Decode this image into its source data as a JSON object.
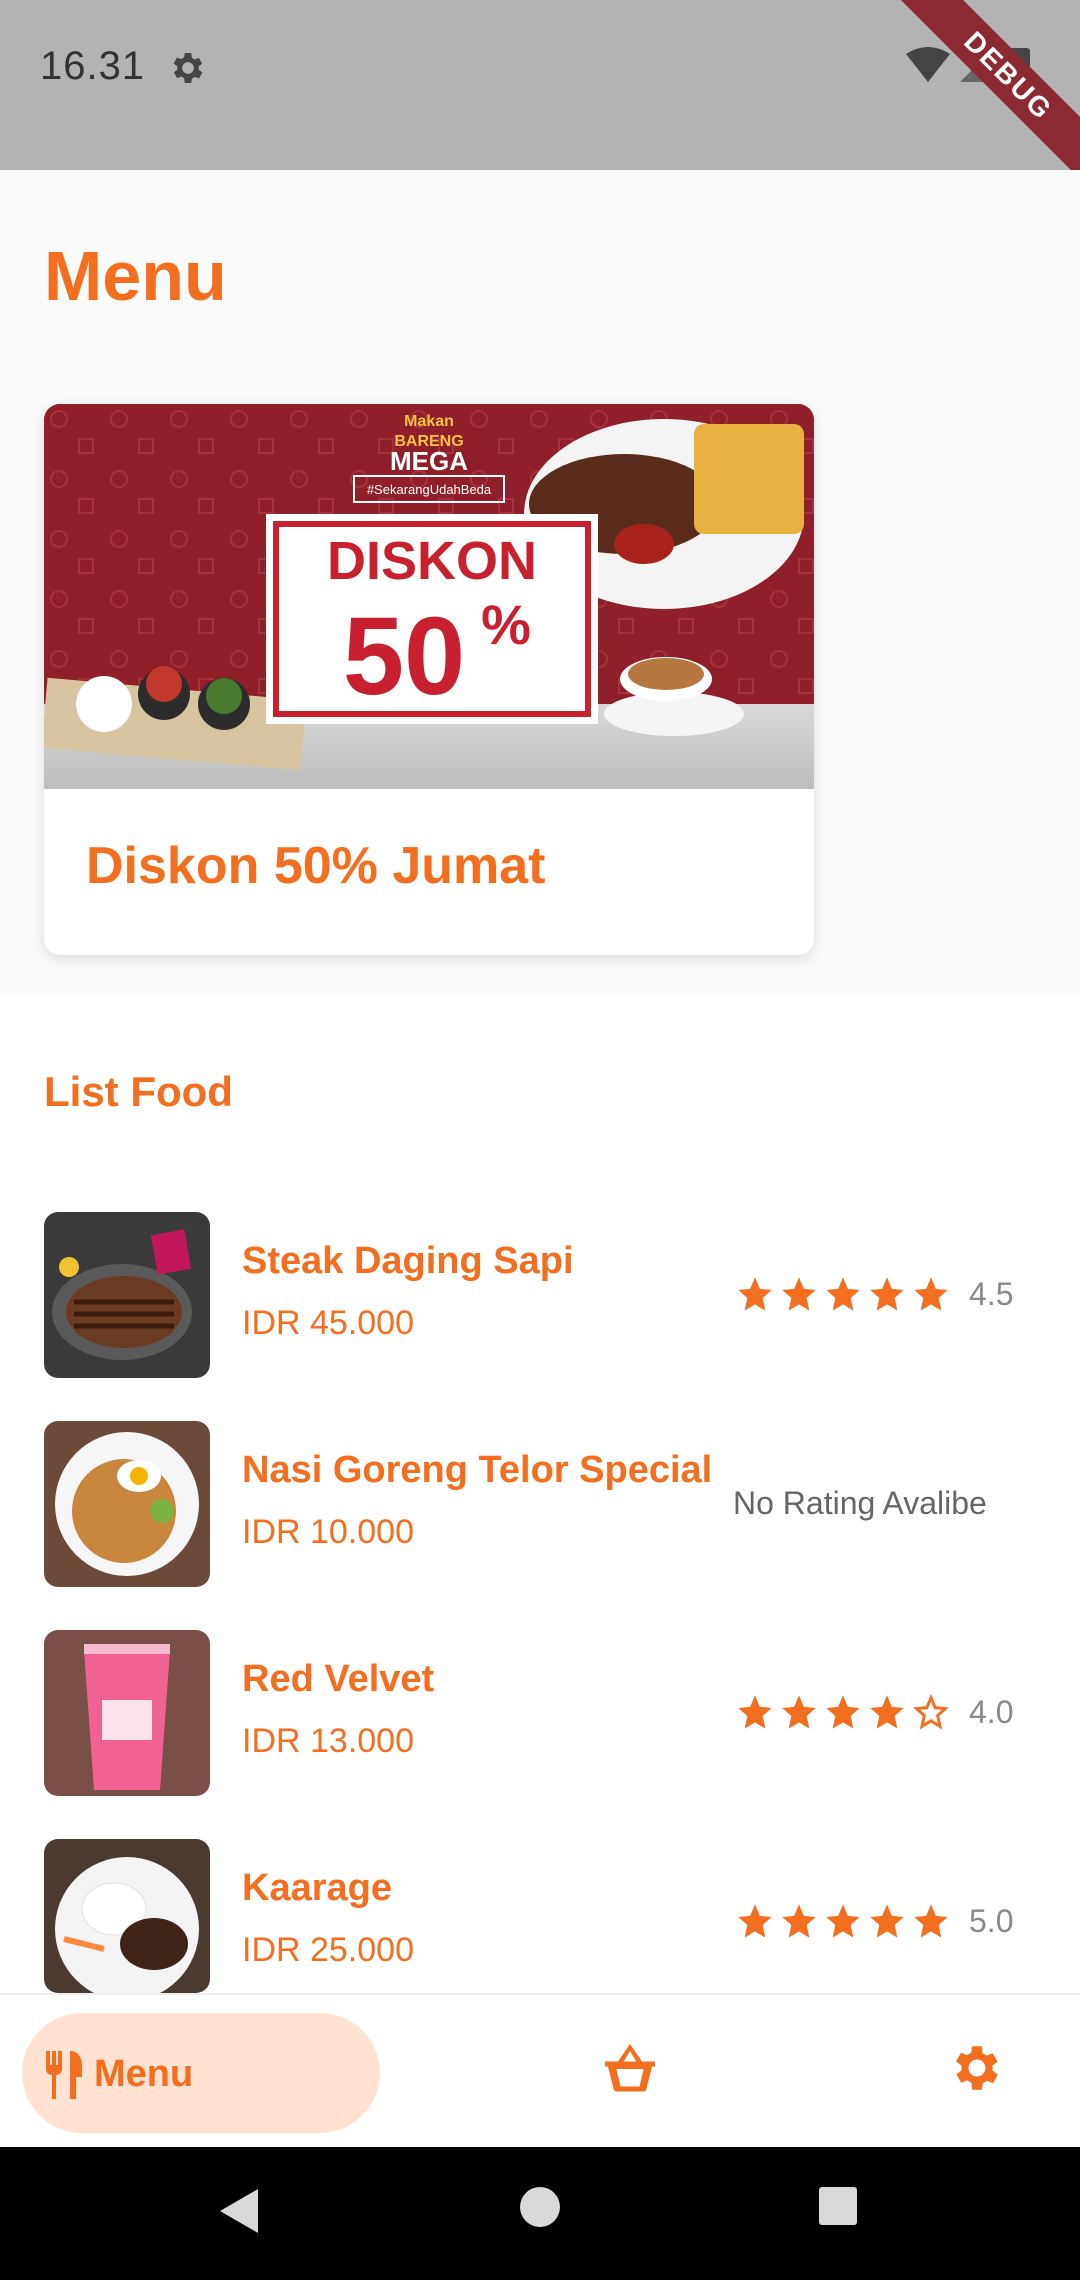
{
  "status_bar": {
    "time": "16.31",
    "debug_label": "DEBUG"
  },
  "header": {
    "title": "Menu"
  },
  "promo": {
    "title": "Diskon 50% Jumat",
    "banner": {
      "brand_top": "Makan",
      "brand_mid": "BARENG",
      "brand_bottom": "MEGA",
      "hashtag": "#SekarangUdahBeda",
      "headline": "DISKON",
      "percent": "50",
      "percent_sign": "%"
    }
  },
  "list": {
    "heading": "List Food",
    "items": [
      {
        "name": "Steak Daging Sapi",
        "price": "IDR 45.000",
        "rating": 4.5,
        "rating_text": "4.5",
        "stars": [
          1,
          1,
          1,
          1,
          1
        ]
      },
      {
        "name": "Nasi Goreng Telor Special",
        "price": "IDR 10.000",
        "rating": null,
        "no_rating_text": "No Rating Avalibe"
      },
      {
        "name": "Red Velvet",
        "price": "IDR 13.000",
        "rating": 4.0,
        "rating_text": "4.0",
        "stars": [
          1,
          1,
          1,
          1,
          0
        ]
      },
      {
        "name": "Kaarage",
        "price": "IDR 25.000",
        "rating": 5.0,
        "rating_text": "5.0",
        "stars": [
          1,
          1,
          1,
          1,
          1
        ]
      }
    ]
  },
  "bottom_nav": {
    "items": [
      {
        "label": "Menu",
        "icon": "utensils-icon",
        "active": true
      },
      {
        "label": "",
        "icon": "basket-icon",
        "active": false
      },
      {
        "label": "",
        "icon": "gear-icon",
        "active": false
      }
    ]
  },
  "colors": {
    "accent": "#f36e1e",
    "accent_soft": "#ffe2d2",
    "status_bar": "#b3b3b3",
    "debug_banner": "#8b2a33"
  }
}
